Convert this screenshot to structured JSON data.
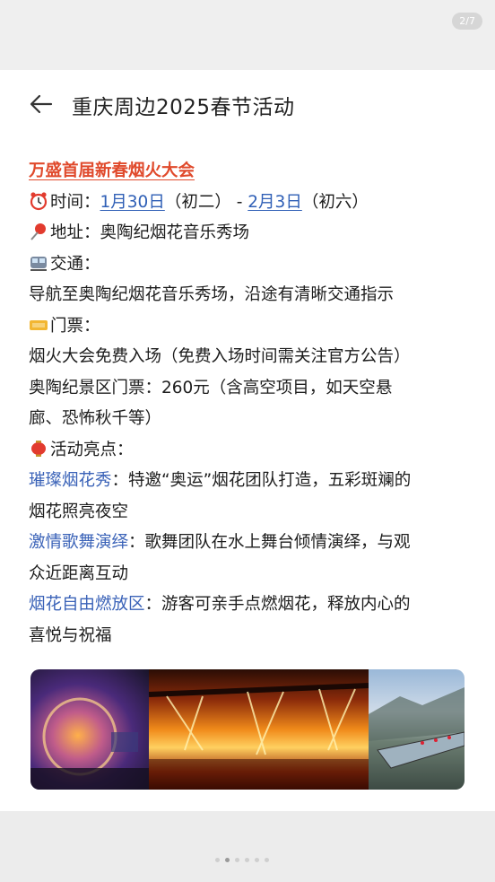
{
  "counter": "2/7",
  "header": {
    "title": "重庆周边2025春节活动"
  },
  "post": {
    "event_title": "万盛首届新春烟火大会",
    "time": {
      "label": "时间：",
      "start": "1月30日",
      "start_note": "（初二）",
      "sep": " - ",
      "end": "2月3日",
      "end_note": "（初六）"
    },
    "address": {
      "label": "地址：",
      "value": "奥陶纪烟花音乐秀场"
    },
    "transport": {
      "label": "交通：",
      "value": "导航至奥陶纪烟花音乐秀场，沿途有清晰交通指示"
    },
    "ticket": {
      "label": "门票：",
      "line1": "烟火大会免费入场（免费入场时间需关注官方公告）",
      "line2a": "奥陶纪景区门票：260元（含高空项目，如天空悬",
      "line2b": "廊、恐怖秋千等）"
    },
    "highlights": {
      "label": "活动亮点：",
      "items": [
        {
          "name": "璀璨烟花秀",
          "sep": "：",
          "desc_a": "特邀“奥运”烟花团队打造，五彩斑斓的",
          "desc_b": "烟花照亮夜空"
        },
        {
          "name": "激情歌舞演绎",
          "sep": "：",
          "desc_a": "歌舞团队在水上舞台倾情演绎，与观",
          "desc_b": "众近距离互动"
        },
        {
          "name": "烟花自由燃放区",
          "sep": "：",
          "desc_a": "游客可亲手点燃烟花，释放内心的",
          "desc_b": "喜悦与祝福"
        }
      ]
    }
  },
  "colors": {
    "accent_red": "#e04a2c",
    "link_blue": "#2f5fb6"
  },
  "pagination": {
    "total": 6,
    "active": 1
  }
}
